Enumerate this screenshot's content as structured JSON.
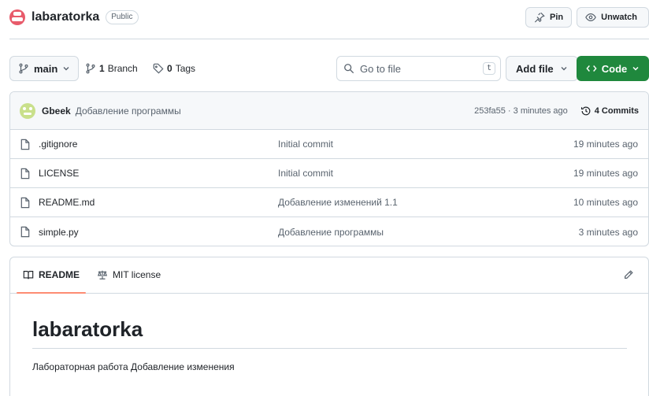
{
  "repo": {
    "name": "labaratorka",
    "visibility": "Public",
    "avatar_color": "#e85b6b"
  },
  "top_actions": {
    "pin_label": "Pin",
    "unwatch_label": "Unwatch"
  },
  "toolbar": {
    "branch_name": "main",
    "branches_count": "1",
    "branches_label": "Branch",
    "tags_count": "0",
    "tags_label": "Tags",
    "goto_placeholder": "Go to file",
    "goto_shortcut": "t",
    "add_file_label": "Add file",
    "code_label": "Code",
    "code_color": "#1f883d"
  },
  "latest_commit": {
    "user": "Gbeek",
    "message": "Добавление программы",
    "meta": "253fa55 · 3 minutes ago",
    "commits_label": "4 Commits"
  },
  "files": [
    {
      "name": ".gitignore",
      "commit": "Initial commit",
      "time": "19 minutes ago"
    },
    {
      "name": "LICENSE",
      "commit": "Initial commit",
      "time": "19 minutes ago"
    },
    {
      "name": "README.md",
      "commit": "Добавление изменений 1.1",
      "time": "10 minutes ago"
    },
    {
      "name": "simple.py",
      "commit": "Добавление программы",
      "time": "3 minutes ago"
    }
  ],
  "readme": {
    "tab_readme": "README",
    "tab_license": "MIT license",
    "title": "labaratorka",
    "text": "Лабораторная работа Добавление изменения"
  }
}
